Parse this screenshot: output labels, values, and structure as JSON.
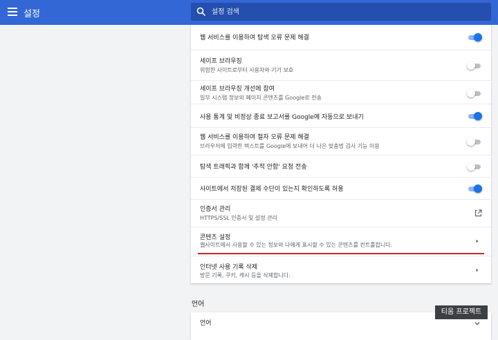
{
  "header": {
    "title": "설정",
    "search_placeholder": "설정 검색"
  },
  "rows": [
    {
      "title": "웹 서비스를 이용하여 탐색 오류 문제 해결",
      "subtitle": "",
      "control": "toggle",
      "on": true
    },
    {
      "title": "세이프 브라우징",
      "subtitle": "위험한 사이트로부터 사용자와 기기 보호",
      "control": "toggle",
      "on": false
    },
    {
      "title": "세이프 브라우징 개선에 참여",
      "subtitle": "일부 시스템 정보와 페이지 콘텐츠를 Google로 전송",
      "control": "toggle",
      "on": false
    },
    {
      "title": "사용 통계 및 비정상 종료 보고서를 Google에 자동으로 보내기",
      "subtitle": "",
      "control": "toggle",
      "on": true
    },
    {
      "title": "웹 서비스를 이용하여 철자 오류 문제 해결",
      "subtitle": "브라우저에 입력한 텍스트를 Google에 보내어 더 나은 맞춤법 검사 기능 이용",
      "control": "toggle",
      "on": false
    },
    {
      "title": "탐색 트래픽과 함께 '추적 안함' 요청 전송",
      "subtitle": "",
      "control": "toggle",
      "on": false
    },
    {
      "title": "사이트에서 저장된 결제 수단이 있는지 확인하도록 허용",
      "subtitle": "",
      "control": "toggle",
      "on": true
    },
    {
      "title": "인증서 관리",
      "subtitle": "HTTPS/SSL 인증서 및 설정 관리",
      "control": "external"
    },
    {
      "title": "콘텐츠 설정",
      "subtitle": "웹사이트에서 사용할 수 있는 정보와 나에게 표시할 수 있는 콘텐츠를 컨트롤합니다.",
      "control": "chevron"
    },
    {
      "title": "인터넷 사용 기록 삭제",
      "subtitle": "방문 기록, 쿠키, 캐시 등을 삭제합니다.",
      "control": "chevron"
    }
  ],
  "language_section": {
    "title": "언어",
    "row_title": "언어"
  },
  "watermark": "티움 프로젝트",
  "colors": {
    "header_bg": "#3367d6",
    "toggle_on": "#1a73e8",
    "highlight_underline": "#c62828"
  }
}
